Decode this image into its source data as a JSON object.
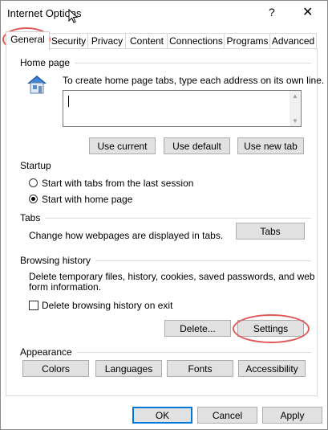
{
  "window": {
    "title": "Internet Options",
    "help_glyph": "?",
    "close_glyph": "✕"
  },
  "tabs": [
    {
      "label": "General",
      "active": true
    },
    {
      "label": "Security"
    },
    {
      "label": "Privacy"
    },
    {
      "label": "Content"
    },
    {
      "label": "Connections"
    },
    {
      "label": "Programs"
    },
    {
      "label": "Advanced"
    }
  ],
  "home_page": {
    "group_label": "Home page",
    "instructions": "To create home page tabs, type each address on its own line.",
    "address_value": "",
    "buttons": {
      "use_current": "Use current",
      "use_default": "Use default",
      "use_new_tab": "Use new tab"
    }
  },
  "startup": {
    "group_label": "Startup",
    "option_last_session": "Start with tabs from the last session",
    "option_home_page": "Start with home page",
    "selected": "home_page"
  },
  "tabs_group": {
    "group_label": "Tabs",
    "description": "Change how webpages are displayed in tabs.",
    "button": "Tabs"
  },
  "browsing_history": {
    "group_label": "Browsing history",
    "description_line1": "Delete temporary files, history, cookies, saved passwords, and web",
    "description_line2": "form information.",
    "delete_on_exit_label": "Delete browsing history on exit",
    "delete_on_exit_checked": false,
    "delete_button": "Delete...",
    "settings_button": "Settings"
  },
  "appearance": {
    "group_label": "Appearance",
    "buttons": {
      "colors": "Colors",
      "languages": "Languages",
      "fonts": "Fonts",
      "accessibility": "Accessibility"
    }
  },
  "footer": {
    "ok": "OK",
    "cancel": "Cancel",
    "apply": "Apply"
  },
  "colors": {
    "highlight_ring": "#e05a5a",
    "primary_border": "#0078d7"
  }
}
